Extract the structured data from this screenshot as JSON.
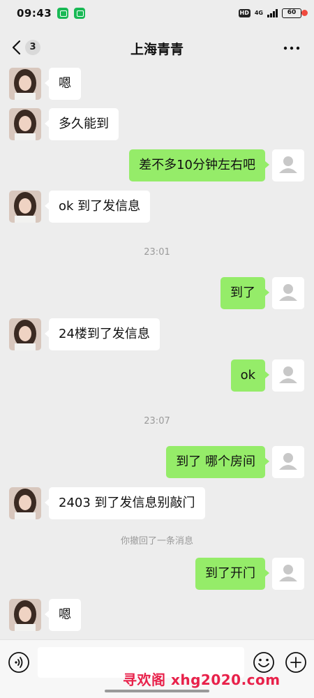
{
  "status_bar": {
    "time": "09:43",
    "hd": "HD",
    "network": "4G",
    "battery": "60"
  },
  "header": {
    "unread_count": "3",
    "title": "上海青青"
  },
  "messages": [
    {
      "side": "left",
      "text": "嗯"
    },
    {
      "side": "left",
      "text": "多久能到"
    },
    {
      "side": "right",
      "text": "差不多10分钟左右吧"
    },
    {
      "side": "left",
      "text": "ok  到了发信息"
    },
    {
      "type": "time",
      "text": "23:01"
    },
    {
      "side": "right",
      "text": "到了"
    },
    {
      "side": "left",
      "text": "24楼到了发信息"
    },
    {
      "side": "right",
      "text": "ok"
    },
    {
      "type": "time",
      "text": "23:07"
    },
    {
      "side": "right",
      "text": "到了 哪个房间"
    },
    {
      "side": "left",
      "text": "2403 到了发信息别敲门"
    },
    {
      "type": "system",
      "text": "你撤回了一条消息"
    },
    {
      "side": "right",
      "text": "到了开门"
    },
    {
      "side": "left",
      "text": "嗯"
    }
  ],
  "input": {
    "value": ""
  },
  "watermark": "寻欢阁 xhg2020.com",
  "colors": {
    "background": "#ededed",
    "outgoing_bubble": "#95ec69",
    "incoming_bubble": "#ffffff",
    "badge_dot": "#f04a3e",
    "watermark": "#e8214a"
  }
}
